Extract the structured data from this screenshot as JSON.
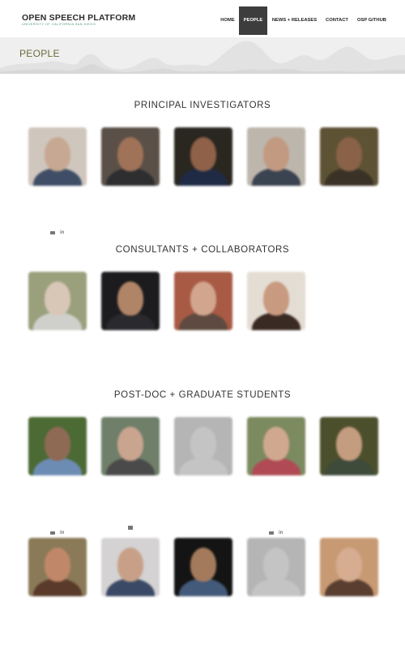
{
  "header": {
    "logo_title": "OPEN SPEECH PLATFORM",
    "logo_subtitle": "UNIVERSITY OF CALIFORNIA SAN DIEGO",
    "nav": [
      {
        "label": "HOME",
        "active": false
      },
      {
        "label": "PEOPLE",
        "active": true
      },
      {
        "label": "NEWS + RELEASES",
        "active": false
      },
      {
        "label": "CONTACT",
        "active": false
      },
      {
        "label": "OSP GITHUB",
        "active": false
      }
    ]
  },
  "banner": {
    "title": "PEOPLE"
  },
  "sections": [
    {
      "heading": "PRINCIPAL INVESTIGATORS",
      "people": [
        {
          "name": "",
          "desc": "",
          "social": [
            "envelope-icon",
            "linkedin-icon"
          ],
          "photo": {
            "bg": "#cfc6bd",
            "skin": "#c7a892",
            "cloth": "#3f4e66"
          }
        },
        {
          "name": "",
          "desc": "",
          "social": [],
          "photo": {
            "bg": "#5a5048",
            "skin": "#a07258",
            "cloth": "#2e2e30"
          }
        },
        {
          "name": "",
          "desc": "",
          "social": [],
          "photo": {
            "bg": "#2a2620",
            "skin": "#8e6148",
            "cloth": "#1f2a44"
          }
        },
        {
          "name": "",
          "desc": "",
          "social": [],
          "photo": {
            "bg": "#bdb6ad",
            "skin": "#c29a82",
            "cloth": "#3a4350"
          }
        },
        {
          "name": "",
          "desc": "",
          "social": [],
          "photo": {
            "bg": "#5e5235",
            "skin": "#8a6248",
            "cloth": "#3a3226"
          }
        }
      ]
    },
    {
      "heading": "CONSULTANTS + COLLABORATORS",
      "people": [
        {
          "name": "",
          "desc": "",
          "social": [],
          "photo": {
            "bg": "#9aa07c",
            "skin": "#d8c6b6",
            "cloth": "#cfd0cc"
          }
        },
        {
          "name": "",
          "desc": "",
          "social": [],
          "photo": {
            "bg": "#1c1c1e",
            "skin": "#b08466",
            "cloth": "#2a2a2e"
          }
        },
        {
          "name": "",
          "desc": "",
          "social": [],
          "photo": {
            "bg": "#a85a44",
            "skin": "#d2a58e",
            "cloth": "#5e4a40"
          }
        },
        {
          "name": "",
          "desc": "",
          "social": [],
          "photo": {
            "bg": "#e4ddd4",
            "skin": "#c89a80",
            "cloth": "#3a2a24"
          }
        }
      ]
    },
    {
      "heading": "POST-DOC + GRADUATE STUDENTS",
      "people": [
        {
          "name": "",
          "desc": "",
          "social": [
            "envelope-icon",
            "linkedin-icon"
          ],
          "photo": {
            "bg": "#4c6a34",
            "skin": "#8e6a54",
            "cloth": "#6d8cb4"
          }
        },
        {
          "name": "",
          "desc": "",
          "social": [
            "envelope-icon"
          ],
          "photo": {
            "bg": "#6f7f6a",
            "skin": "#c9a48e",
            "cloth": "#4a4a4a"
          }
        },
        {
          "name": "",
          "desc": "",
          "social": [],
          "photo": {
            "bg": "#b5b5b5",
            "skin": "#c4c4c4",
            "cloth": "#c4c4c4"
          },
          "placeholder": true
        },
        {
          "name": "",
          "desc": "",
          "social": [
            "envelope-icon",
            "linkedin-icon"
          ],
          "photo": {
            "bg": "#7c8a60",
            "skin": "#d0a890",
            "cloth": "#b04a54"
          }
        },
        {
          "name": "",
          "desc": "",
          "social": [],
          "photo": {
            "bg": "#4c4f2c",
            "skin": "#c49c80",
            "cloth": "#3e4a3a"
          }
        },
        {
          "name": "",
          "desc": "",
          "social": [],
          "photo": {
            "bg": "#8a7a58",
            "skin": "#c08868",
            "cloth": "#5a3a2a"
          }
        },
        {
          "name": "",
          "desc": "",
          "social": [],
          "photo": {
            "bg": "#d4d2d2",
            "skin": "#c8a088",
            "cloth": "#3a4a66"
          }
        },
        {
          "name": "",
          "desc": "",
          "social": [],
          "photo": {
            "bg": "#141414",
            "skin": "#a47a5c",
            "cloth": "#445a7a"
          }
        },
        {
          "name": "",
          "desc": "",
          "social": [],
          "photo": {
            "bg": "#b5b5b5",
            "skin": "#c4c4c4",
            "cloth": "#c4c4c4"
          },
          "placeholder": true
        },
        {
          "name": "",
          "desc": "",
          "social": [],
          "photo": {
            "bg": "#c89a74",
            "skin": "#d6ad90",
            "cloth": "#5a3e30"
          }
        }
      ]
    }
  ]
}
